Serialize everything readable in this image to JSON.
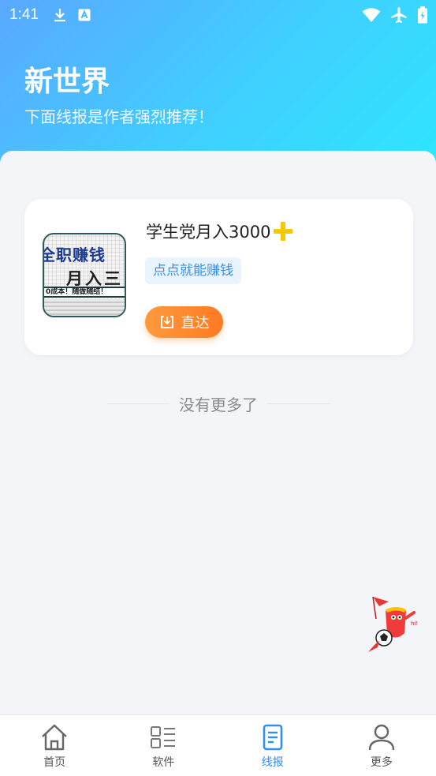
{
  "status_bar": {
    "time": "1:41",
    "left_icons": [
      "download-icon",
      "font-app-icon"
    ],
    "right_icons": [
      "wifi-icon",
      "airplane-icon",
      "battery-icon"
    ]
  },
  "header": {
    "title": "新世界",
    "subtitle": "下面线报是作者强烈推荐！",
    "gradient_colors": [
      "#5aa8ff",
      "#3fd0ff",
      "#2ee6ff"
    ]
  },
  "list": {
    "items": [
      {
        "thumbnail": {
          "line1": "全职赚钱",
          "line2": "月入三",
          "line3": "0成本！随做随结！"
        },
        "title": "学生党月入3000",
        "title_emoji": "plus-icon",
        "tag": "点点就能赚钱",
        "button_label": "直达",
        "button_icon": "download-box-icon"
      }
    ],
    "end_text": "没有更多了"
  },
  "floating_mascot": "soccer-mascot-icon",
  "tabbar": {
    "active_color": "#2f8ef0",
    "tabs": [
      {
        "label": "首页",
        "icon": "home-icon"
      },
      {
        "label": "软件",
        "icon": "list-icon"
      },
      {
        "label": "线报",
        "icon": "document-icon",
        "active": true
      },
      {
        "label": "更多",
        "icon": "user-icon"
      }
    ]
  }
}
